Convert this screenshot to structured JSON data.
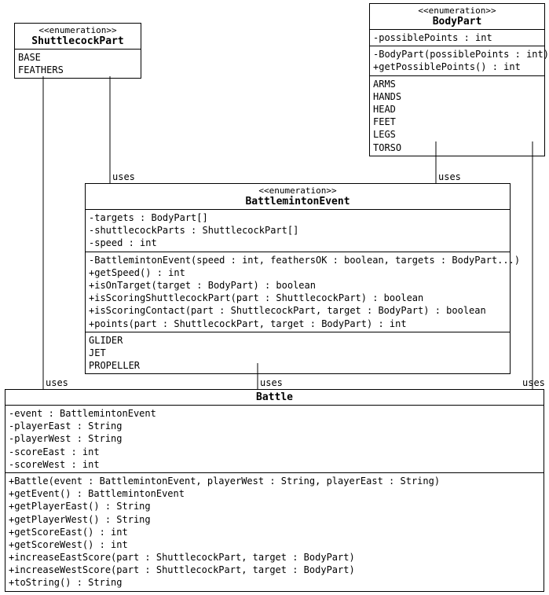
{
  "shuttlecockPart": {
    "stereotype": "<<enumeration>>",
    "name": "ShuttlecockPart",
    "values": [
      "BASE",
      "FEATHERS"
    ]
  },
  "bodyPart": {
    "stereotype": "<<enumeration>>",
    "name": "BodyPart",
    "attrs": [
      "-possiblePoints : int"
    ],
    "methods": [
      "-BodyPart(possiblePoints : int)",
      "+getPossiblePoints() : int"
    ],
    "values": [
      "ARMS",
      "HANDS",
      "HEAD",
      "FEET",
      "LEGS",
      "TORSO"
    ]
  },
  "battlemintonEvent": {
    "stereotype": "<<enumeration>>",
    "name": "BattlemintonEvent",
    "attrs": [
      "-targets : BodyPart[]",
      "-shuttlecockParts : ShuttlecockPart[]",
      "-speed : int"
    ],
    "methods": [
      "-BattlemintonEvent(speed : int, feathersOK : boolean, targets : BodyPart...)",
      "+getSpeed() : int",
      "+isOnTarget(target : BodyPart) : boolean",
      "+isScoringShuttlecockPart(part : ShuttlecockPart) : boolean",
      "+isScoringContact(part : ShuttlecockPart, target : BodyPart) : boolean",
      "+points(part : ShuttlecockPart, target : BodyPart) : int"
    ],
    "values": [
      "GLIDER",
      "JET",
      "PROPELLER"
    ]
  },
  "battle": {
    "name": "Battle",
    "attrs": [
      "-event : BattlemintonEvent",
      "-playerEast : String",
      "-playerWest : String",
      "-scoreEast : int",
      "-scoreWest : int"
    ],
    "methods": [
      "+Battle(event : BattlemintonEvent, playerWest : String, playerEast : String)",
      "+getEvent() : BattlemintonEvent",
      "+getPlayerEast() : String",
      "+getPlayerWest() : String",
      "+getScoreEast() : int",
      "+getScoreWest() : int",
      "+increaseEastScore(part : ShuttlecockPart, target : BodyPart)",
      "+increaseWestScore(part : ShuttlecockPart, target : BodyPart)",
      "+toString() : String"
    ]
  },
  "relLabels": {
    "uses1": "uses",
    "uses2": "uses",
    "uses3": "uses",
    "uses4": "uses",
    "uses5": "uses"
  }
}
